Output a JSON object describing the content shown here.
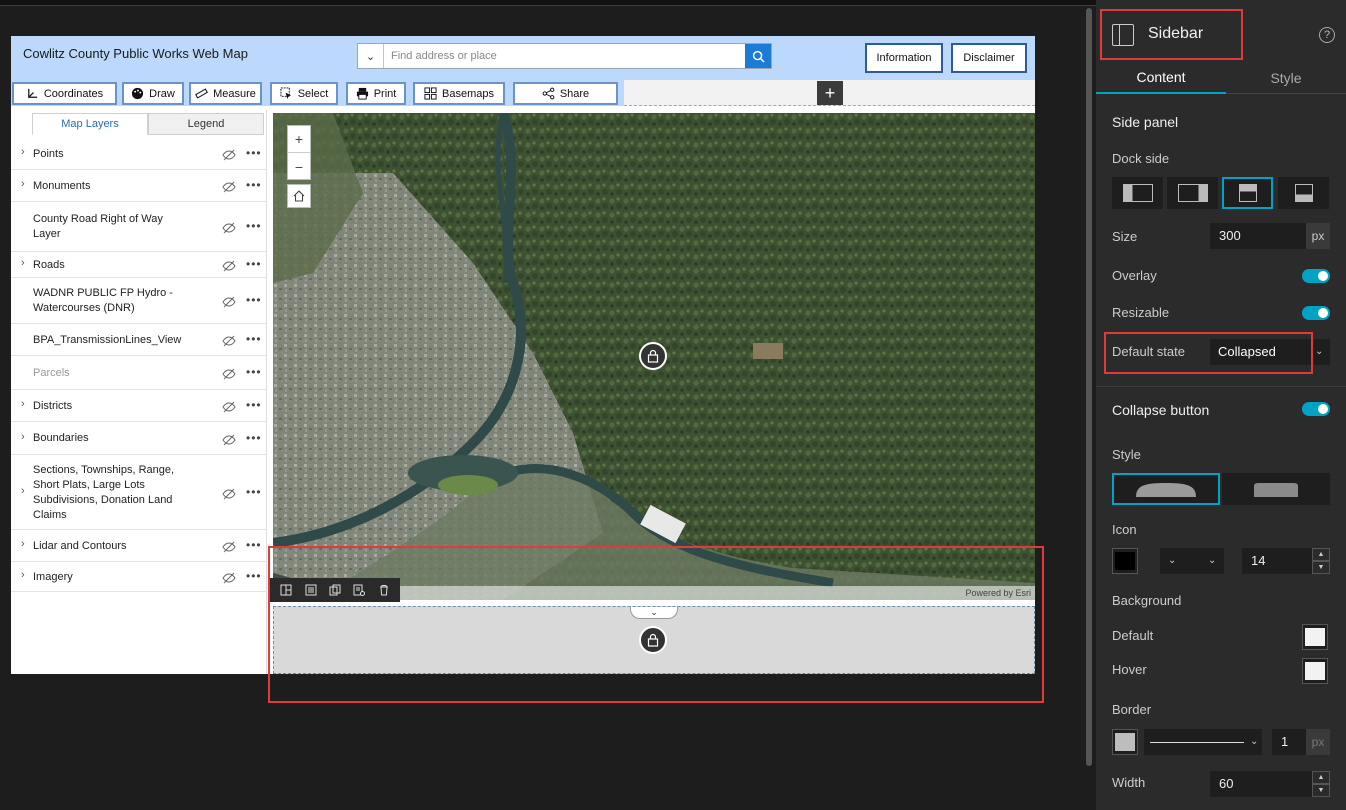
{
  "app": {
    "title": "Cowlitz County Public Works Web Map",
    "search_placeholder": "Find address or place",
    "header_buttons": [
      "Information",
      "Disclaimer"
    ],
    "toolbar": [
      "Coordinates",
      "Draw",
      "Measure",
      "Select",
      "Print",
      "Basemaps",
      "Share"
    ],
    "layer_tabs": [
      "Map Layers",
      "Legend"
    ],
    "layers": [
      {
        "name": "Points",
        "expandable": true
      },
      {
        "name": "Monuments",
        "expandable": true
      },
      {
        "name": "County Road Right of Way Layer",
        "expandable": false
      },
      {
        "name": "Roads",
        "expandable": true
      },
      {
        "name": "WADNR PUBLIC FP Hydro - Watercourses (DNR)",
        "expandable": false
      },
      {
        "name": "BPA_TransmissionLines_View",
        "expandable": false
      },
      {
        "name": "Parcels",
        "expandable": false
      },
      {
        "name": "Districts",
        "expandable": true
      },
      {
        "name": "Boundaries",
        "expandable": true
      },
      {
        "name": "Sections, Townships, Range, Short Plats, Large Lots Subdivisions, Donation Land Claims",
        "expandable": true
      },
      {
        "name": "Lidar and Contours",
        "expandable": true
      },
      {
        "name": "Imagery",
        "expandable": true
      }
    ],
    "zoom_in": "+",
    "zoom_out": "−",
    "attribution": "Powered by Esri",
    "add_widget": "+"
  },
  "panel": {
    "title": "Sidebar",
    "help": "?",
    "tabs": [
      "Content",
      "Style"
    ],
    "side_panel_heading": "Side panel",
    "dock_side_label": "Dock side",
    "size_label": "Size",
    "size_value": "300",
    "size_unit": "px",
    "overlay_label": "Overlay",
    "overlay_on": true,
    "resizable_label": "Resizable",
    "resizable_on": true,
    "default_state_label": "Default state",
    "default_state_value": "Collapsed",
    "collapse_button_label": "Collapse button",
    "collapse_button_on": true,
    "style_label": "Style",
    "icon_label": "Icon",
    "icon_size": "14",
    "background_label": "Background",
    "bg_default_label": "Default",
    "bg_hover_label": "Hover",
    "border_label": "Border",
    "border_width": "1",
    "border_unit": "px",
    "width_label": "Width",
    "width_value": "60"
  },
  "colors": {
    "accent": "#00a3c4",
    "highlight": "#e03a3a",
    "header_bg": "#bcd8fb"
  }
}
